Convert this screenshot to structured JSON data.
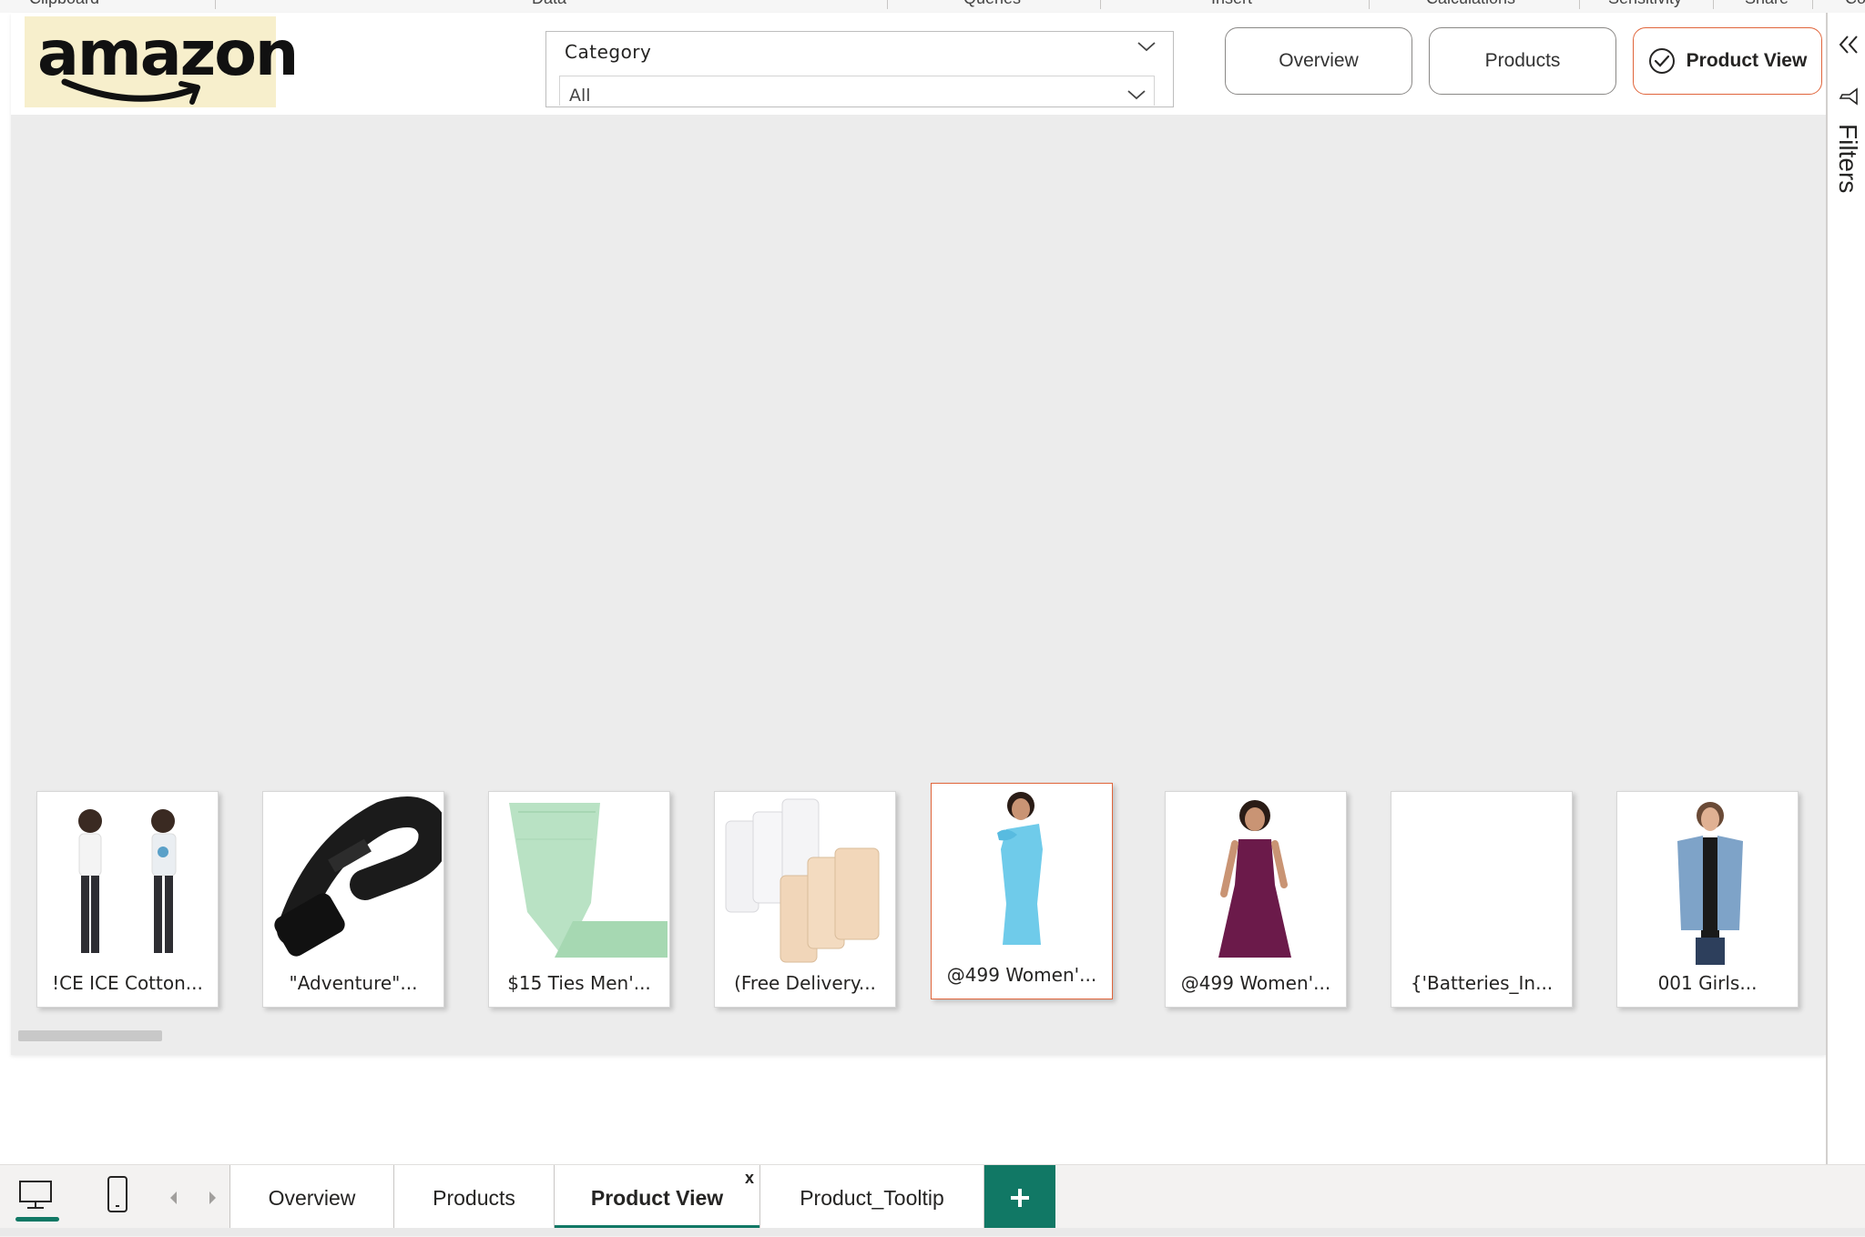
{
  "ribbon": {
    "groups": [
      "Clipboard",
      "Data",
      "Queries",
      "Insert",
      "Calculations",
      "Sensitivity",
      "Share",
      "Co"
    ]
  },
  "logo": {
    "text": "amazon"
  },
  "slicer": {
    "title": "Category",
    "value": "All"
  },
  "nav_buttons": {
    "overview": "Overview",
    "products": "Products",
    "product_view": "Product View"
  },
  "products": [
    {
      "caption": "!CE ICE Cotton...",
      "selected": false
    },
    {
      "caption": "\"Adventure\"...",
      "selected": false
    },
    {
      "caption": "$15 Ties Men'...",
      "selected": false
    },
    {
      "caption": "(Free Delivery...",
      "selected": false
    },
    {
      "caption": "@499 Women'...",
      "selected": true
    },
    {
      "caption": "@499 Women'...",
      "selected": false
    },
    {
      "caption": "{'Batteries_In...",
      "selected": false
    },
    {
      "caption": "001 Girls...",
      "selected": false
    }
  ],
  "filters_pane": {
    "label": "Filters"
  },
  "page_tabs": {
    "tabs": [
      "Overview",
      "Products",
      "Product View",
      "Product_Tooltip"
    ],
    "active": "Product View",
    "close_label": "x"
  },
  "colors": {
    "accent": "#e0653b",
    "tab_accent": "#117865",
    "logo_bg": "#f7efcc"
  }
}
